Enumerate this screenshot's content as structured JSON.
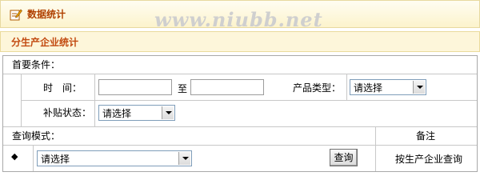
{
  "header": {
    "title": "数据统计",
    "watermark": "www.niubb.net"
  },
  "section": {
    "title": "分生产企业统计"
  },
  "conditions": {
    "title": "首要条件：",
    "time_label": "时　间：",
    "date_from": "",
    "to_label": "至",
    "date_to": "",
    "product_type_label": "产品类型：",
    "product_type_value": "请选择",
    "subsidy_label": "补贴状态：",
    "subsidy_value": "请选择"
  },
  "query": {
    "mode_label": "查询模式：",
    "remark_header": "备注",
    "bullet": "◆",
    "mode_value": "请选择",
    "button_label": "查询",
    "remark_text": "按生产企业查询"
  }
}
